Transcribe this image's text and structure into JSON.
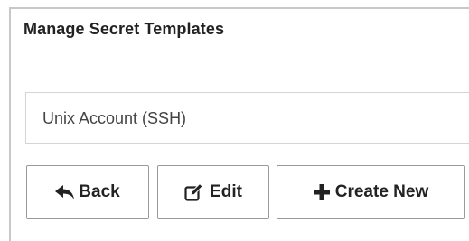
{
  "panel": {
    "title": "Manage Secret Templates"
  },
  "template_select": {
    "selected_value": "Unix Account (SSH)"
  },
  "toolbar": {
    "back_label": "Back",
    "back_icon": "reply-arrow-icon",
    "edit_label": "Edit",
    "edit_icon": "edit-icon",
    "create_label": "Create New",
    "create_icon": "plus-icon"
  }
}
